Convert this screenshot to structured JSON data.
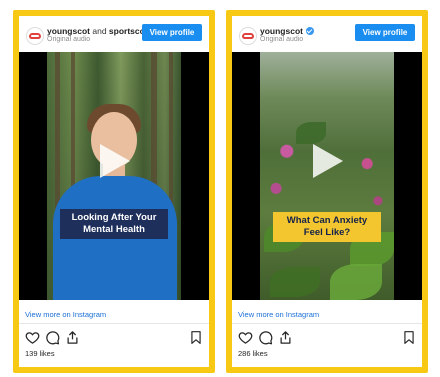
{
  "posts": [
    {
      "username": "youngscot",
      "username_joiner": "and",
      "collaborator": "sportsco",
      "verified": false,
      "subtitle": "Original audio",
      "view_profile": "View profile",
      "caption": "Looking After Your\nMental Health",
      "view_more": "View more on Instagram",
      "likes": "139 likes"
    },
    {
      "username": "youngscot",
      "verified": true,
      "subtitle": "Original audio",
      "view_profile": "View profile",
      "caption": "What Can Anxiety\nFeel Like?",
      "view_more": "View more on Instagram",
      "likes": "286 likes"
    }
  ],
  "colors": {
    "frame": "#f7c814",
    "button": "#1a8ef0",
    "link": "#1a6fd6",
    "caption1_bg": "#1e2f5c",
    "caption2_bg": "#f3c52e"
  },
  "icons": [
    "heart-icon",
    "comment-icon",
    "share-icon",
    "bookmark-icon",
    "play-icon",
    "verified-icon"
  ]
}
